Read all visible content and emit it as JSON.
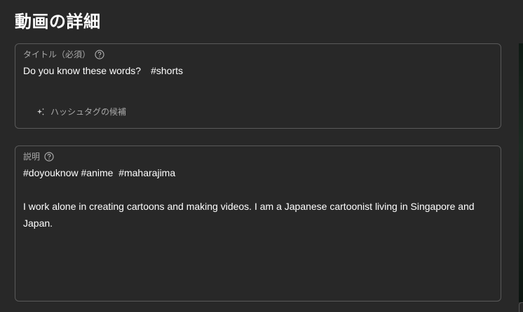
{
  "header": {
    "title": "動画の詳細"
  },
  "title_field": {
    "label": "タイトル（必須）",
    "value": "Do you know these words?　#shorts",
    "hashtag_suggestion": "ハッシュタグの候補"
  },
  "description_field": {
    "label": "説明",
    "value": "#doyouknow #anime  #maharajima\n\nI work alone in creating cartoons and making videos. I am a Japanese cartoonist living in Singapore and Japan."
  },
  "icons": {
    "help": "help-circle-icon",
    "hashtag": "sparkle-icon"
  },
  "colors": {
    "background": "#282828",
    "border": "#5a5a5a",
    "muted_text": "#aaaaaa",
    "text": "#ffffff"
  }
}
